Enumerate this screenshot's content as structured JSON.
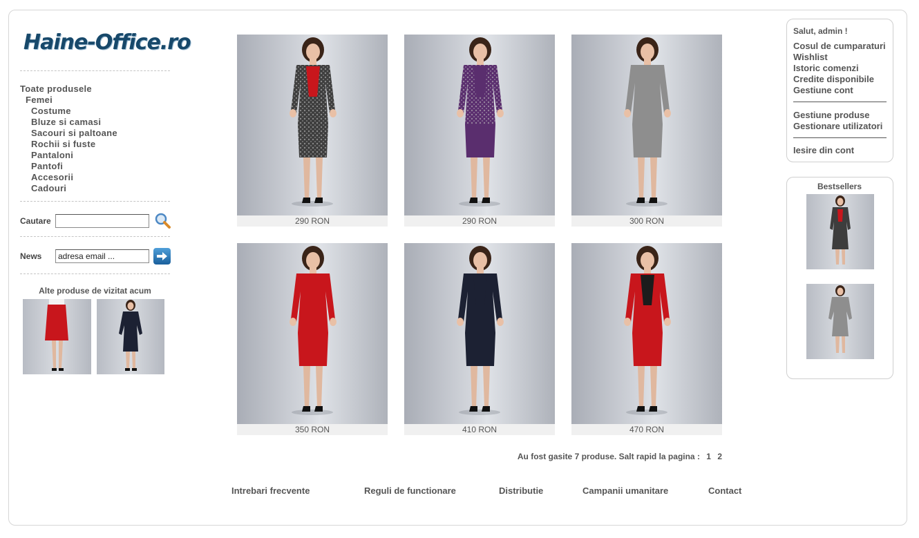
{
  "logo": {
    "text": "Haine-Office.ro"
  },
  "categories": [
    {
      "label": "Toate produsele"
    },
    {
      "label": "Femei"
    },
    {
      "label": "Costume"
    },
    {
      "label": "Bluze si camasi"
    },
    {
      "label": "Sacouri si paltoane"
    },
    {
      "label": "Rochii si fuste"
    },
    {
      "label": "Pantaloni"
    },
    {
      "label": "Pantofi"
    },
    {
      "label": "Accesorii"
    },
    {
      "label": "Cadouri"
    }
  ],
  "search": {
    "label": "Cautare",
    "value": ""
  },
  "news": {
    "label": "News",
    "value": "adresa email ..."
  },
  "visit": {
    "title": "Alte produse de vizitat acum"
  },
  "products": [
    {
      "price": "290 RON",
      "outfit": "grey-black lace suit"
    },
    {
      "price": "290 RON",
      "outfit": "purple tweed suit"
    },
    {
      "price": "300 RON",
      "outfit": "grey tweed suit"
    },
    {
      "price": "350 RON",
      "outfit": "red suit"
    },
    {
      "price": "410 RON",
      "outfit": "navy suit"
    },
    {
      "price": "470 RON",
      "outfit": "red suit"
    }
  ],
  "pagination": {
    "text": "Au fost gasite 7 produse. Salt rapid la pagina :",
    "pages": [
      "1",
      "2"
    ]
  },
  "footer": [
    "Intrebari frecvente",
    "Reguli de functionare",
    "Distributie",
    "Campanii umanitare",
    "Contact"
  ],
  "account": {
    "greeting": "Salut, admin !",
    "links1": [
      "Cosul de cumparaturi",
      "Wishlist",
      "Istoric comenzi",
      "Credite disponibile",
      "Gestiune cont"
    ],
    "links2": [
      "Gestiune produse",
      "Gestionare utilizatori"
    ],
    "logout": "Iesire din cont"
  },
  "bestsellers": {
    "title": "Bestsellers"
  },
  "colors": {
    "skin": "#e9c0a6",
    "hair": "#3a2418",
    "red": "#c8161c",
    "navy": "#1c2133",
    "purple": "#5a2e6e",
    "grey": "#8e8e8e"
  }
}
